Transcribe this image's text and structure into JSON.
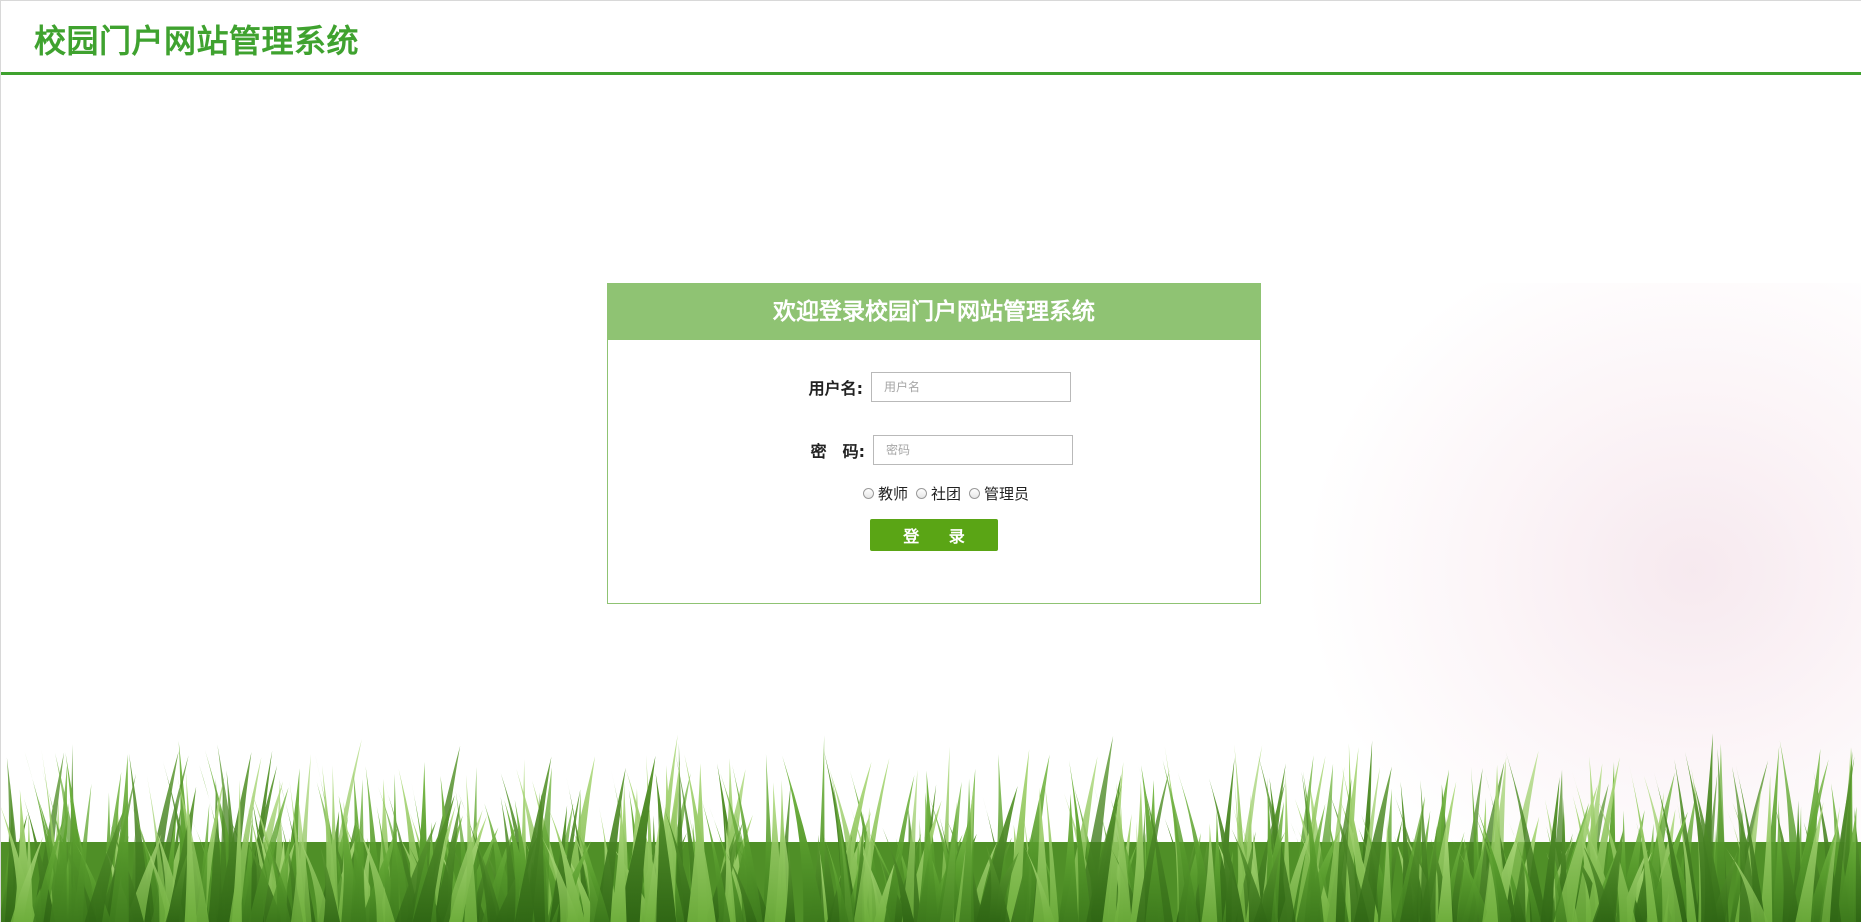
{
  "header": {
    "title": "校园门户网站管理系统"
  },
  "login": {
    "heading": "欢迎登录校园门户网站管理系统",
    "username_label": "用户名:",
    "username_placeholder": "用户名",
    "username_value": "",
    "password_label": "密　码:",
    "password_placeholder": "密码",
    "password_value": "",
    "roles": [
      {
        "label": "教师",
        "selected": false
      },
      {
        "label": "社团",
        "selected": false
      },
      {
        "label": "管理员",
        "selected": false
      }
    ],
    "submit_label": "登 录"
  },
  "colors": {
    "brand_green": "#3fa22f",
    "panel_header": "#8fc373",
    "button_green": "#5aa515"
  },
  "decorations": {
    "background_image": "grass-illustration"
  }
}
